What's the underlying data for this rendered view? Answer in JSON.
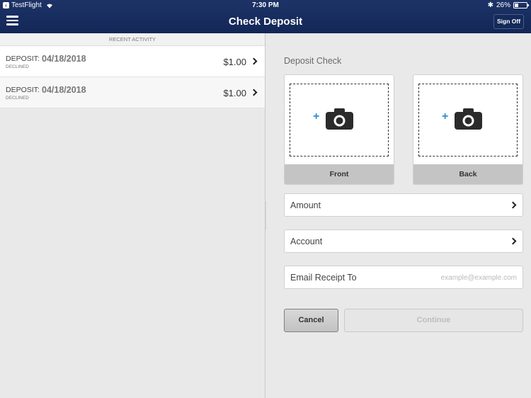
{
  "status_bar": {
    "back_app": "TestFlight",
    "time": "7:30 PM",
    "battery": "26%",
    "battery_level": 0.26
  },
  "nav": {
    "title": "Check Deposit",
    "sign_off": "Sign Off"
  },
  "recent_activity": {
    "header": "RECENT ACTIVITY",
    "items": [
      {
        "type": "DEPOSIT:",
        "date": "04/18/2018",
        "status": "DECLINED",
        "amount": "$1.00"
      },
      {
        "type": "DEPOSIT:",
        "date": "04/18/2018",
        "status": "DECLINED",
        "amount": "$1.00"
      }
    ]
  },
  "deposit": {
    "title": "Deposit Check",
    "front_label": "Front",
    "back_label": "Back",
    "amount_label": "Amount",
    "account_label": "Account",
    "email_label": "Email Receipt To",
    "email_placeholder": "example@example.com",
    "cancel": "Cancel",
    "continue": "Continue"
  },
  "colors": {
    "nav_bg": "#1d3367",
    "accent_plus": "#2b8fd8"
  }
}
